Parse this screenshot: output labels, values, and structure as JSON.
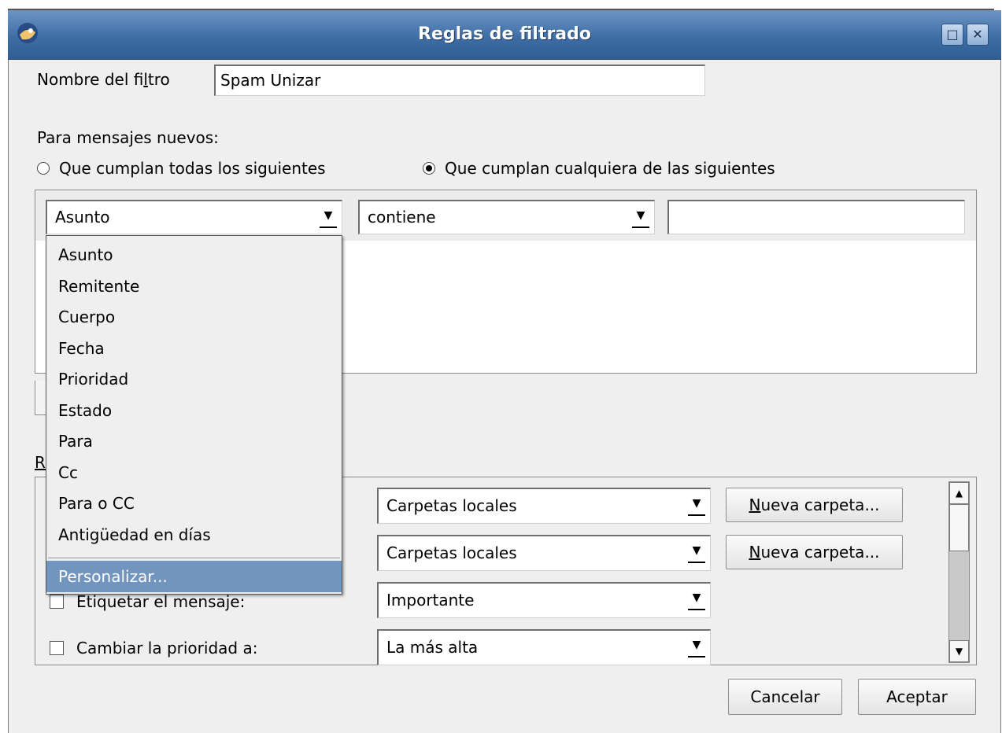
{
  "window": {
    "title": "Reglas de filtrado",
    "maximize_glyph": "□",
    "close_glyph": "✕"
  },
  "filter_name": {
    "label_prefix": "Nombre del fi",
    "label_accel": "l",
    "label_suffix": "tro",
    "value": "Spam Unizar"
  },
  "new_messages": {
    "label": "Para mensajes nuevos:",
    "match_all_label": "Que cumplan todas los siguientes",
    "match_any_label": "Que cumplan cualquiera de las siguientes",
    "selected": "any"
  },
  "criteria_row": {
    "field_value": "Asunto",
    "operator_value": "contiene",
    "text_value": ""
  },
  "field_dropdown": {
    "items": [
      "Asunto",
      "Remitente",
      "Cuerpo",
      "Fecha",
      "Prioridad",
      "Estado",
      "Para",
      "Cc",
      "Para o CC",
      "Antigüedad en días"
    ],
    "custom_item": "Personalizar..."
  },
  "partial_label": "R",
  "actions": {
    "move_to_value": "Carpetas locales",
    "copy_to_value": "Carpetas locales",
    "new_folder_prefix": "",
    "new_folder_accel": "N",
    "new_folder_suffix": "ueva carpeta...",
    "tag_label": "Etiquetar el mensaje:",
    "tag_value": "Importante",
    "priority_label": "Cambiar la prioridad a:",
    "priority_value": "La más alta"
  },
  "footer": {
    "cancel_label": "Cancelar",
    "accept_label": "Aceptar"
  },
  "arrow_glyph": "▼",
  "scroll_up_glyph": "▲",
  "scroll_down_glyph": "▼"
}
